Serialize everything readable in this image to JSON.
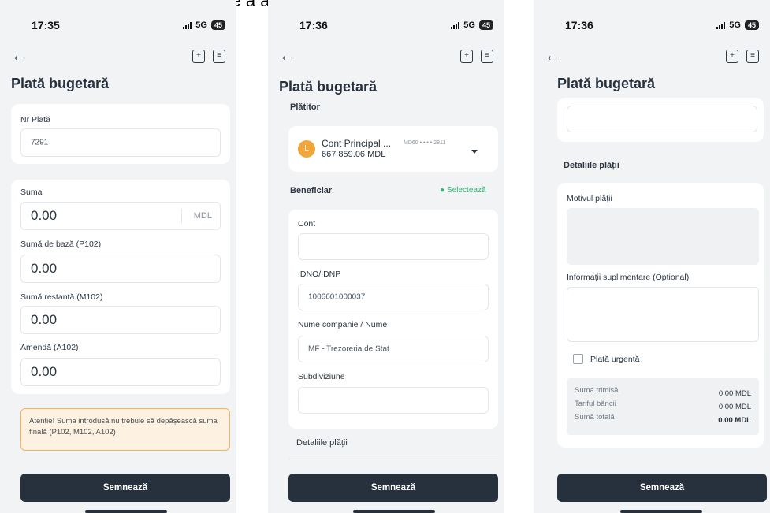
{
  "caption": "tilizatorul având posibilitatea de a alege inclusiv contul/ie de card.",
  "statusbar": {
    "time1": "17:35",
    "time2": "17:36",
    "time3": "17:36",
    "network": "5G",
    "battery": "45"
  },
  "screen": {
    "title": "Plată bugetară",
    "sign_button": "Semnează"
  },
  "screen1": {
    "nr_plata_label": "Nr Plată",
    "nr_plata_value": "7291",
    "suma_label": "Suma",
    "suma_value": "0.00",
    "currency": "MDL",
    "p102_label": "Sumă de bază (P102)",
    "p102_value": "0.00",
    "m102_label": "Sumă restantă (M102)",
    "m102_value": "0.00",
    "a102_label": "Amendă (A102)",
    "a102_value": "0.00",
    "warning": "Atenție! Suma introdusă nu trebuie să depășească suma finală (P102, M102, A102)"
  },
  "screen2": {
    "platitor_label": "Plătitor",
    "account_name": "Cont Principal ...",
    "account_iban": "MD60 • • • • 2811",
    "account_balance": "667 859.06 MDL",
    "account_initial": "L",
    "beneficiar_label": "Beneficiar",
    "select_link": "Selectează",
    "cont_label": "Cont",
    "cont_value": "",
    "idno_label": "IDNO/IDNP",
    "idno_value": "1006601000037",
    "nume_label": "Nume companie / Nume",
    "nume_value": "MF - Trezoreria de Stat",
    "subdiv_label": "Subdiviziune",
    "subdiv_value": "",
    "detalii_label": "Detaliile plății"
  },
  "screen3": {
    "detalii_label": "Detaliile plății",
    "motiv_label": "Motivul plății",
    "info_label": "Informații suplimentare (Opțional)",
    "urgent_label": "Plată urgentă",
    "summary": [
      {
        "label": "Suma trimisă",
        "value": "0.00 MDL"
      },
      {
        "label": "Tariful băncii",
        "value": "0.00 MDL"
      },
      {
        "label": "Sumă totală",
        "value": "0.00 MDL"
      }
    ]
  }
}
